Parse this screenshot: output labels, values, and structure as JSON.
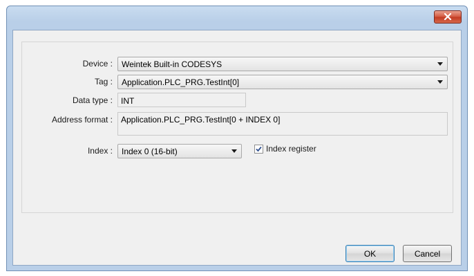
{
  "window": {
    "close_icon": "close-icon",
    "close_color": "#c7462d"
  },
  "fields": {
    "device": {
      "label": "Device :",
      "value": "Weintek Built-in CODESYS"
    },
    "tag": {
      "label": "Tag :",
      "value": "Application.PLC_PRG.TestInt[0]"
    },
    "data_type": {
      "label": "Data type :",
      "value": "INT"
    },
    "address_format": {
      "label": "Address format :",
      "value": "Application.PLC_PRG.TestInt[0 + INDEX 0]"
    },
    "index": {
      "label": "Index :",
      "value": "Index 0 (16-bit)"
    },
    "index_register": {
      "label": "Index register",
      "checked": true
    }
  },
  "buttons": {
    "ok": "OK",
    "cancel": "Cancel"
  }
}
